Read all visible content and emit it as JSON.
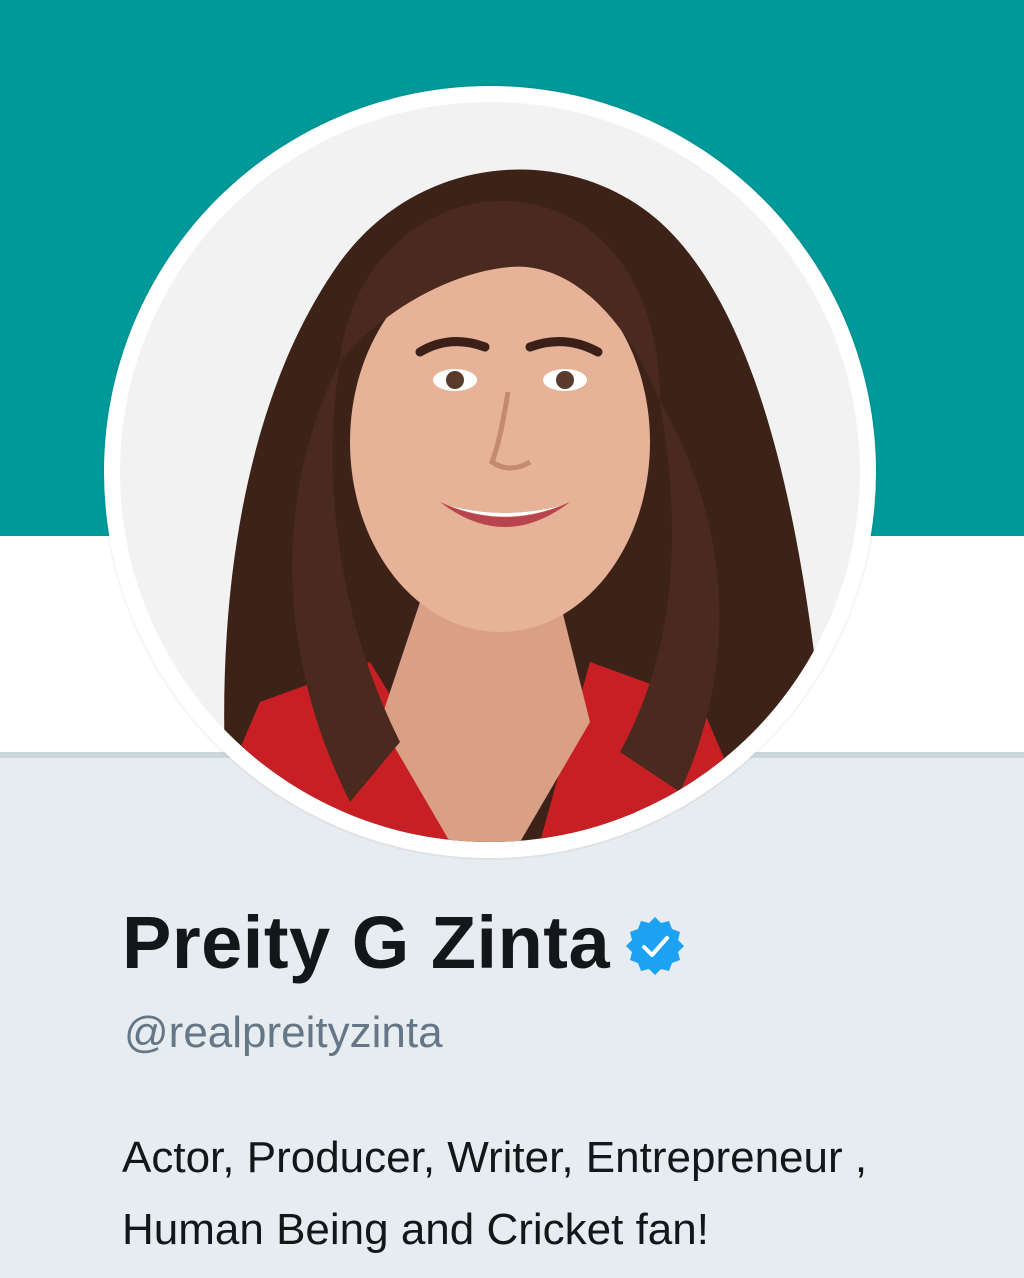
{
  "profile": {
    "name": "Preity G Zinta",
    "handle": "@realpreityzinta",
    "bio": "Actor, Producer, Writer, Entrepreneur , Human Being and Cricket fan!",
    "verified": true,
    "verified_icon": "verified-check-icon",
    "avatar_icon": "profile-photo"
  },
  "colors": {
    "banner": "#009999",
    "page_background": "#e6ecf0",
    "verified_badge": "#1da1f2",
    "name_text": "#14171a",
    "handle_text": "#657786"
  }
}
